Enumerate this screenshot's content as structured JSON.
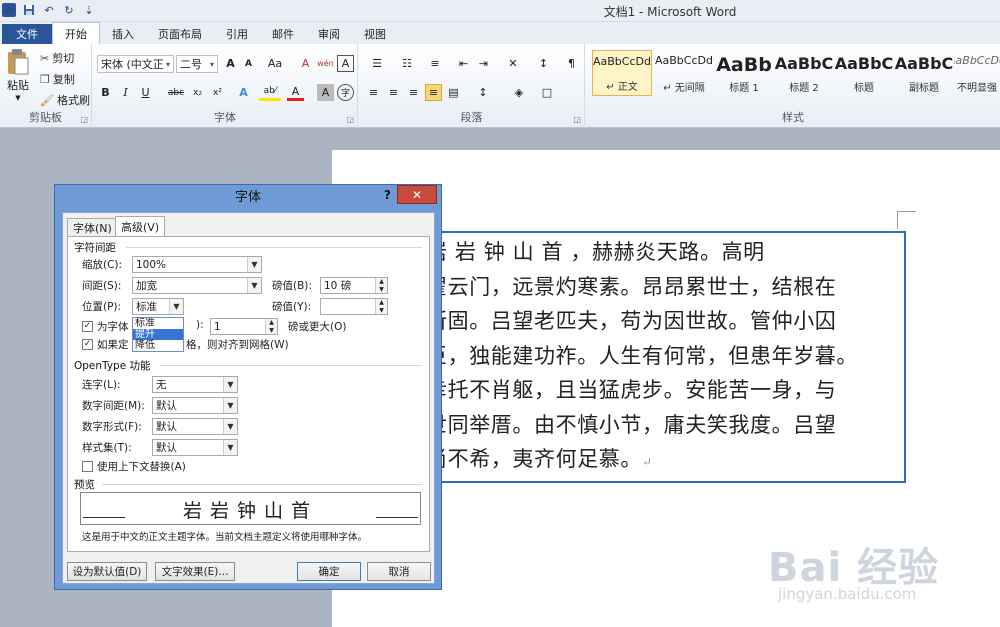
{
  "window": {
    "title": "文档1 - Microsoft Word",
    "word_logo": "W",
    "qat_undo_glyph": "↶",
    "qat_redo_glyph": "↻",
    "qat_more_glyph": "⇣"
  },
  "tabs": [
    "文件",
    "开始",
    "插入",
    "页面布局",
    "引用",
    "邮件",
    "审阅",
    "视图"
  ],
  "ribbon": {
    "clipboard": {
      "paste": "粘贴",
      "cut": "剪切",
      "copy": "复制",
      "format_painter": "格式刷",
      "label": "剪贴板"
    },
    "font": {
      "font_name": "宋体 (中文正",
      "font_size": "二号",
      "grow": "A",
      "shrink": "A",
      "change_case": "Aa",
      "clear_format": "A",
      "wen": "wén",
      "bold": "B",
      "italic": "I",
      "underline": "U",
      "strike": "abc",
      "subscript": "x₂",
      "superscript": "x²",
      "text_effects": "A",
      "highlight": "ab⁄",
      "font_color": "A",
      "char_shading": "A",
      "enclose": "字",
      "label": "字体"
    },
    "paragraph": {
      "label": "段落"
    },
    "styles": {
      "label": "样式",
      "items": [
        {
          "sample": "AaBbCcDd",
          "name": "↵ 正文"
        },
        {
          "sample": "AaBbCcDd",
          "name": "↵ 无间隔"
        },
        {
          "sample": "AaBb",
          "name": "标题 1"
        },
        {
          "sample": "AaBbC",
          "name": "标题 2"
        },
        {
          "sample": "AaBbC",
          "name": "标题"
        },
        {
          "sample": "AaBbC",
          "name": "副标题"
        },
        {
          "sample": "AaBbCcDd",
          "name": "不明显强"
        }
      ]
    }
  },
  "document": {
    "lines": [
      "岩 岩 钟 山 首 ，赫赫炎天路。高明",
      "翟云门，远景灼寒素。昂昂累世士，结根在",
      "所固。吕望老匹夫，苟为因世故。管仲小囚",
      "臣，独能建功祚。人生有何常，但患年岁暮。",
      "幸托不肖躯，且当猛虎步。安能苦一身，与",
      "世同举厝。由不慎小节，庸夫笑我度。吕望",
      "尚不希，夷齐何足慕。"
    ],
    "para_mark": "↵"
  },
  "dialog": {
    "title": "字体",
    "help": "?",
    "close": "✕",
    "tab_font": "字体(N)",
    "tab_advanced": "高级(V)",
    "char_spacing_title": "字符间距",
    "scale_label": "缩放(C):",
    "scale_value": "100%",
    "spacing_label": "间距(S):",
    "spacing_value": "加宽",
    "spacing_by_label": "磅值(B):",
    "spacing_by_value": "10 磅",
    "position_label": "位置(P):",
    "position_value": "标准",
    "position_by_label": "磅值(Y):",
    "position_by_value": "",
    "position_options": [
      "标准",
      "提升",
      "降低"
    ],
    "kerning_label": "为字体",
    "kerning_suffix": "):",
    "kerning_value": "1",
    "kerning_tail": "磅或更大(O)",
    "grid_label": "如果定",
    "grid_tail": "格，则对齐到网格(W)",
    "opentype_title": "OpenType 功能",
    "ligatures_label": "连字(L):",
    "ligatures_value": "无",
    "num_spacing_label": "数字间距(M):",
    "num_spacing_value": "默认",
    "num_form_label": "数字形式(F):",
    "num_form_value": "默认",
    "style_set_label": "样式集(T):",
    "style_set_value": "默认",
    "contextual_label": "使用上下文替换(A)",
    "preview_title": "预览",
    "preview_text": "岩岩钟山首",
    "preview_desc": "这是用于中文的正文主题字体。当前文档主题定义将使用哪种字体。",
    "btn_default": "设为默认值(D)",
    "btn_effects": "文字效果(E)...",
    "btn_ok": "确定",
    "btn_cancel": "取消"
  },
  "watermark": {
    "brand": "Bai  经验",
    "url": "jingyan.baidu.com"
  }
}
